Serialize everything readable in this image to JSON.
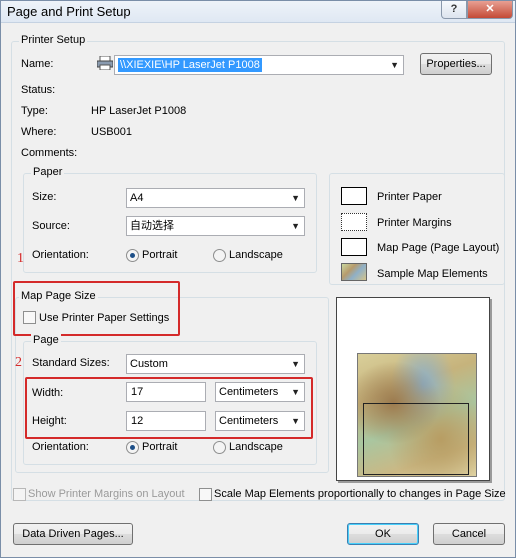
{
  "window": {
    "title": "Page and Print Setup",
    "help_glyph": "?",
    "close_glyph": "✕"
  },
  "printer_setup": {
    "group_label": "Printer Setup",
    "name_label": "Name:",
    "name_value": "\\\\XIEXIE\\HP LaserJet P1008",
    "properties_label": "Properties...",
    "status_label": "Status:",
    "status_value": "",
    "type_label": "Type:",
    "type_value": "HP LaserJet P1008",
    "where_label": "Where:",
    "where_value": "USB001",
    "comments_label": "Comments:",
    "comments_value": ""
  },
  "paper": {
    "group_label": "Paper",
    "size_label": "Size:",
    "size_value": "A4",
    "source_label": "Source:",
    "source_value": "自动选择",
    "orientation_label": "Orientation:",
    "portrait_label": "Portrait",
    "landscape_label": "Landscape",
    "orientation_selected": "Portrait"
  },
  "legend": {
    "items": [
      {
        "label": "Printer Paper",
        "icon": "paper-swatch"
      },
      {
        "label": "Printer Margins",
        "icon": "margin-swatch"
      },
      {
        "label": "Map Page (Page Layout)",
        "icon": "map-page-swatch"
      },
      {
        "label": "Sample Map Elements",
        "icon": "sample-map-swatch"
      }
    ]
  },
  "map_page_size": {
    "group_label": "Map Page Size",
    "use_printer_paper_label": "Use Printer Paper Settings",
    "use_printer_paper_checked": false
  },
  "page": {
    "group_label": "Page",
    "standard_sizes_label": "Standard Sizes:",
    "standard_sizes_value": "Custom",
    "width_label": "Width:",
    "width_value": "17",
    "width_unit": "Centimeters",
    "height_label": "Height:",
    "height_value": "12",
    "height_unit": "Centimeters",
    "orientation_label": "Orientation:",
    "portrait_label": "Portrait",
    "landscape_label": "Landscape",
    "orientation_selected": "Portrait"
  },
  "annotations": {
    "marker_1": "1",
    "marker_2": "2",
    "color": "#d42a2a"
  },
  "options": {
    "show_margins_label": "Show Printer Margins on Layout",
    "show_margins_enabled": false,
    "scale_elements_label": "Scale Map Elements proportionally to changes in Page Size",
    "scale_elements_checked": false
  },
  "buttons": {
    "data_driven_pages": "Data Driven Pages...",
    "ok": "OK",
    "cancel": "Cancel"
  }
}
